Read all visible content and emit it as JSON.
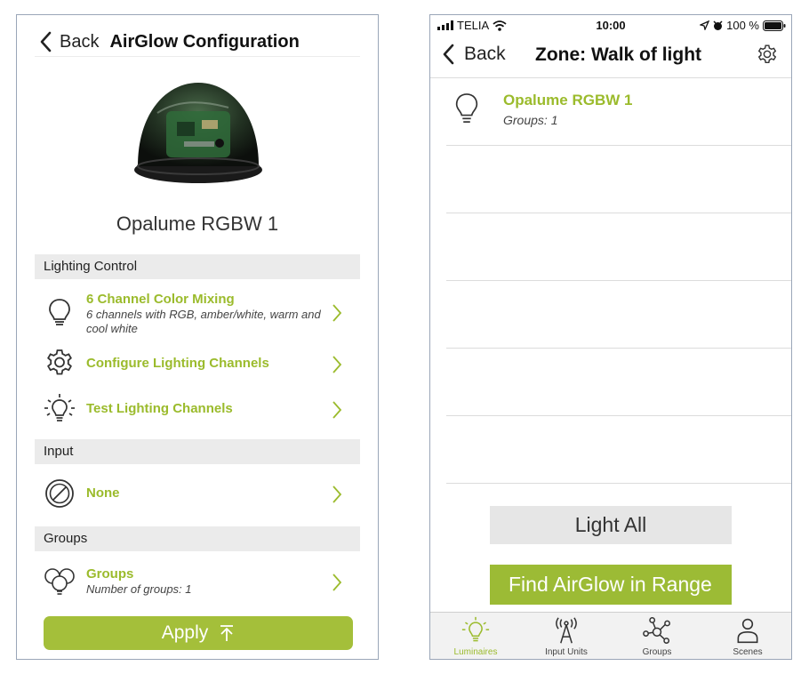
{
  "left": {
    "nav": {
      "back_label": "Back",
      "title": "AirGlow Configuration"
    },
    "device_name": "Opalume RGBW 1",
    "sections": {
      "lighting": "Lighting Control",
      "input": "Input",
      "groups": "Groups"
    },
    "rows": {
      "color_mixing": {
        "title": "6 Channel Color Mixing",
        "subtitle": "6 channels with RGB, amber/white, warm and cool white",
        "icon": "lightbulb-icon"
      },
      "configure": {
        "title": "Configure Lighting Channels",
        "icon": "gear-icon"
      },
      "test": {
        "title": "Test Lighting Channels",
        "icon": "lightbulb-rays-icon"
      },
      "input_none": {
        "title": "None",
        "icon": "none-circle-icon"
      },
      "groups": {
        "title": "Groups",
        "subtitle": "Number of groups: 1",
        "icon": "group-bulbs-icon"
      }
    },
    "apply_label": "Apply"
  },
  "right": {
    "status": {
      "carrier": "TELIA",
      "time": "10:00",
      "battery": "100 %"
    },
    "nav": {
      "back_label": "Back",
      "title": "Zone: Walk of light"
    },
    "luminaires": [
      {
        "name": "Opalume RGBW 1",
        "groups": "Groups: 1"
      }
    ],
    "buttons": {
      "light_all": "Light All",
      "find": "Find AirGlow in Range"
    },
    "tabs": [
      {
        "label": "Luminaires",
        "icon": "luminaire-icon",
        "active": true
      },
      {
        "label": "Input Units",
        "icon": "antenna-icon",
        "active": false
      },
      {
        "label": "Groups",
        "icon": "network-icon",
        "active": false
      },
      {
        "label": "Scenes",
        "icon": "person-icon",
        "active": false
      }
    ]
  },
  "colors": {
    "accent": "#9bbb2c",
    "section_bg": "#ebebeb",
    "button_gray": "#e6e6e6",
    "apply": "#a4bf3a"
  }
}
